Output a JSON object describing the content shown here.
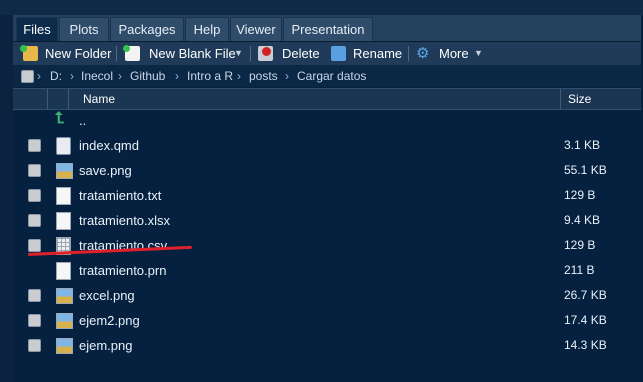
{
  "tabs": [
    {
      "label": "Files",
      "active": true
    },
    {
      "label": "Plots"
    },
    {
      "label": "Packages"
    },
    {
      "label": "Help"
    },
    {
      "label": "Viewer"
    },
    {
      "label": "Presentation"
    }
  ],
  "toolbar": {
    "new_folder": "New Folder",
    "new_blank_file": "New Blank File",
    "delete": "Delete",
    "rename": "Rename",
    "more": "More"
  },
  "breadcrumb": [
    "D:",
    "Inecol",
    "Github",
    "Intro a R",
    "posts",
    "Cargar datos"
  ],
  "columns": {
    "name": "Name",
    "size": "Size"
  },
  "parent_dir": "..",
  "files": [
    {
      "name": "index.qmd",
      "size": "3.1 KB",
      "icon": "qmd-file-icon"
    },
    {
      "name": "save.png",
      "size": "55.1 KB",
      "icon": "image-file-icon"
    },
    {
      "name": "tratamiento.txt",
      "size": "129 B",
      "icon": "text-file-icon"
    },
    {
      "name": "tratamiento.xlsx",
      "size": "9.4 KB",
      "icon": "text-file-icon"
    },
    {
      "name": "tratamiento.csv",
      "size": "129 B",
      "icon": "csv-file-icon"
    },
    {
      "name": "tratamiento.prn",
      "size": "211 B",
      "icon": "text-file-icon"
    },
    {
      "name": "excel.png",
      "size": "26.7 KB",
      "icon": "image-file-icon"
    },
    {
      "name": "ejem2.png",
      "size": "17.4 KB",
      "icon": "image-file-icon"
    },
    {
      "name": "ejem.png",
      "size": "14.3 KB",
      "icon": "image-file-icon"
    }
  ],
  "colors": {
    "background": "#06213f",
    "highlight_underline": "#e0202a",
    "parent_arrow": "#3cb371"
  }
}
